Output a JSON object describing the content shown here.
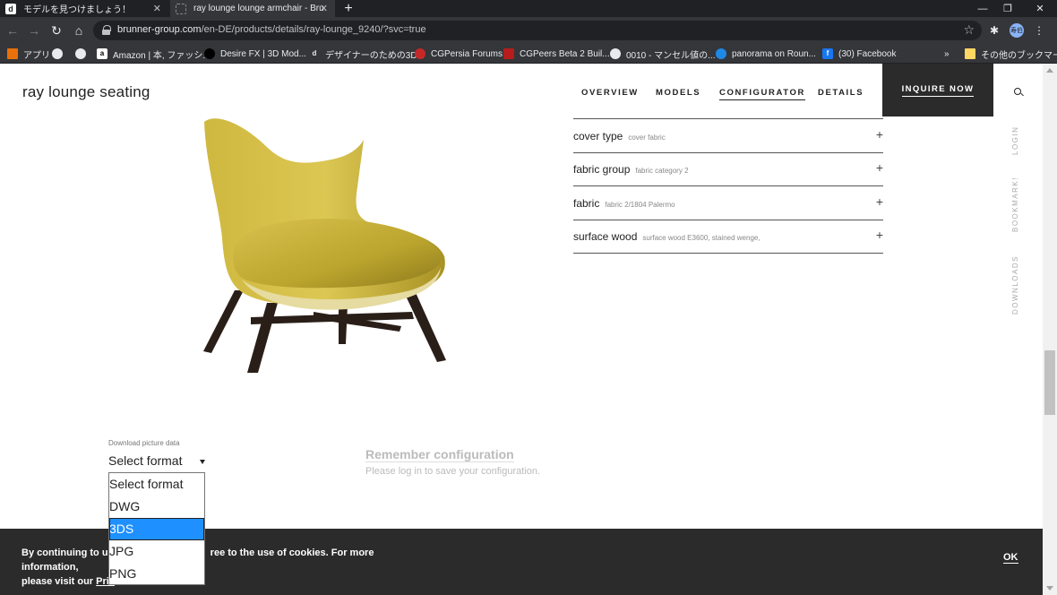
{
  "browser": {
    "tabs": [
      {
        "title": "モデルを見つけましょう！",
        "favicon": "d"
      },
      {
        "title": "ray lounge lounge armchair - Bru"
      }
    ],
    "url_host": "brunner-group.com",
    "url_path": "/en-DE/products/details/ray-lounge_9240/?svc=true",
    "profile_label": "寿伯",
    "bookmarks": [
      "アプリ",
      "",
      "",
      "Amazon | 本, ファッシ...",
      "Desire FX | 3D Mod...",
      "デザイナーのための3D...",
      "CGPersia Forums",
      "CGPeers Beta 2 Buil...",
      "0010 - マンセル値の...",
      "panorama on Roun...",
      "(30) Facebook",
      "»",
      "その他のブックマーク"
    ]
  },
  "site": {
    "brand": "ray lounge seating",
    "nav": [
      "OVERVIEW",
      "MODELS",
      "CONFIGURATOR",
      "DETAILS"
    ],
    "inquire": "INQUIRE NOW",
    "side": [
      "LOGIN",
      "BOOKMARK!",
      "DOWNLOADS"
    ]
  },
  "config": [
    {
      "label": "cover type",
      "value": "cover fabric"
    },
    {
      "label": "fabric group",
      "value": "fabric category 2"
    },
    {
      "label": "fabric",
      "value": "fabric 2/1804 Palermo"
    },
    {
      "label": "surface wood",
      "value": "surface wood E3600, stained wenge,"
    }
  ],
  "download": {
    "label": "Download picture data",
    "selected": "Select format",
    "options": [
      "Select format",
      "DWG",
      "3DS",
      "JPG",
      "PNG"
    ],
    "highlighted_index": 2
  },
  "remember": {
    "title": "Remember configuration",
    "subtitle": "Please log in to save your configuration."
  },
  "cookie": {
    "line1_left": "By continuing to us",
    "line1_right": "ree to the use of cookies. For more information,",
    "line2_left": "please visit our ",
    "line2_link": "Priv",
    "ok": "OK"
  },
  "colors": {
    "chair_fabric": "#c9b23a",
    "chair_legs": "#2a1f18",
    "highlight": "#1e90ff"
  }
}
